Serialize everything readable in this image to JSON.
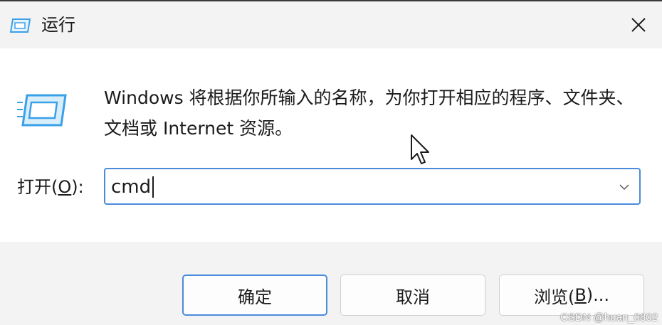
{
  "window": {
    "title": "运行",
    "close_icon": "close-icon"
  },
  "dialog": {
    "description": "Windows 将根据你所输入的名称，为你打开相应的程序、文件夹、文档或 Internet 资源。",
    "open_label_prefix": "打开(",
    "open_label_key": "O",
    "open_label_suffix": "):",
    "command_value": "cmd"
  },
  "buttons": {
    "ok_label": "确定",
    "cancel_label": "取消",
    "browse_prefix": "浏览(",
    "browse_key": "B",
    "browse_suffix": ")..."
  },
  "watermark": "CSDN @huan_0802",
  "colors": {
    "accent": "#4a8bdb",
    "icon_blue": "#3aa0e8"
  }
}
